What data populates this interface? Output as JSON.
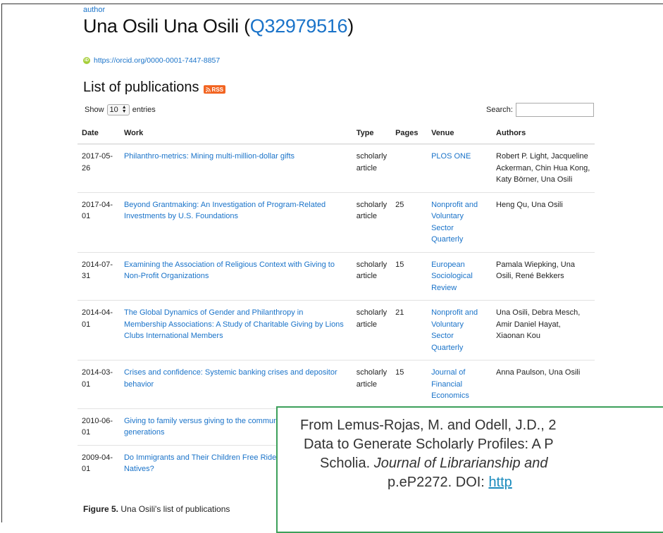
{
  "header": {
    "author_label": "author",
    "name": "Una Osili",
    "qid": "Q32979516",
    "title_open": "Una Osili (",
    "title_close": ")",
    "orcid_url": "https://orcid.org/0000-0001-7447-8857"
  },
  "publications": {
    "heading": "List of publications",
    "rss_label": "RSS",
    "show_label": "Show",
    "entries_value": "10",
    "entries_label": "entries",
    "search_label": "Search:",
    "search_value": "",
    "columns": [
      "Date",
      "Work",
      "Type",
      "Pages",
      "Venue",
      "Authors"
    ],
    "rows": [
      {
        "date": "2017-05-26",
        "work": "Philanthro-metrics: Mining multi-million-dollar gifts",
        "type": "scholarly article",
        "pages": "",
        "venue": "PLOS ONE",
        "authors": "Robert P. Light, Jacqueline Ackerman, Chin Hua Kong, Katy Börner, Una Osili"
      },
      {
        "date": "2017-04-01",
        "work": "Beyond Grantmaking: An Investigation of Program-Related Investments by U.S. Foundations",
        "type": "scholarly article",
        "pages": "25",
        "venue": "Nonprofit and Voluntary Sector Quarterly",
        "authors": "Heng Qu, Una Osili"
      },
      {
        "date": "2014-07-31",
        "work": "Examining the Association of Religious Context with Giving to Non-Profit Organizations",
        "type": "scholarly article",
        "pages": "15",
        "venue": "European Sociological Review",
        "authors": "Pamala Wiepking, Una Osili, René Bekkers"
      },
      {
        "date": "2014-04-01",
        "work": "The Global Dynamics of Gender and Philanthropy in Membership Associations: A Study of Charitable Giving by Lions Clubs International Members",
        "type": "scholarly article",
        "pages": "21",
        "venue": "Nonprofit and Voluntary Sector Quarterly",
        "authors": "Una Osili, Debra Mesch, Amir Daniel Hayat, Xiaonan Kou"
      },
      {
        "date": "2014-03-01",
        "work": "Crises and confidence: Systemic banking crises and depositor behavior",
        "type": "scholarly article",
        "pages": "15",
        "venue": "Journal of Financial Economics",
        "authors": "Anna Paulson, Una Osili"
      },
      {
        "date": "2010-06-01",
        "work": "Giving to family versus giving to the community within and across generations",
        "type": "",
        "pages": "",
        "venue": "",
        "authors": ""
      },
      {
        "date": "2009-04-01",
        "work": "Do Immigrants and Their Children Free Ride More Than Natives?",
        "type": "",
        "pages": "",
        "venue": "",
        "authors": ""
      }
    ]
  },
  "caption": {
    "label": "Figure 5.",
    "text": "Una Osili's list of publications"
  },
  "citation": {
    "line1": "From Lemus-Rojas, M. and Odell, J.D., 2",
    "line2": "Data to Generate Scholarly Profiles: A P",
    "line3_plain": "Scholia.",
    "line3_italic": "Journal of Librarianship and",
    "line4_plain": "p.eP2272. DOI:",
    "line4_link": "http"
  },
  "colors": {
    "link": "#1a73c9",
    "rss": "#f26522",
    "orcid": "#a6ce39",
    "overlay_border": "#3ca05a"
  }
}
